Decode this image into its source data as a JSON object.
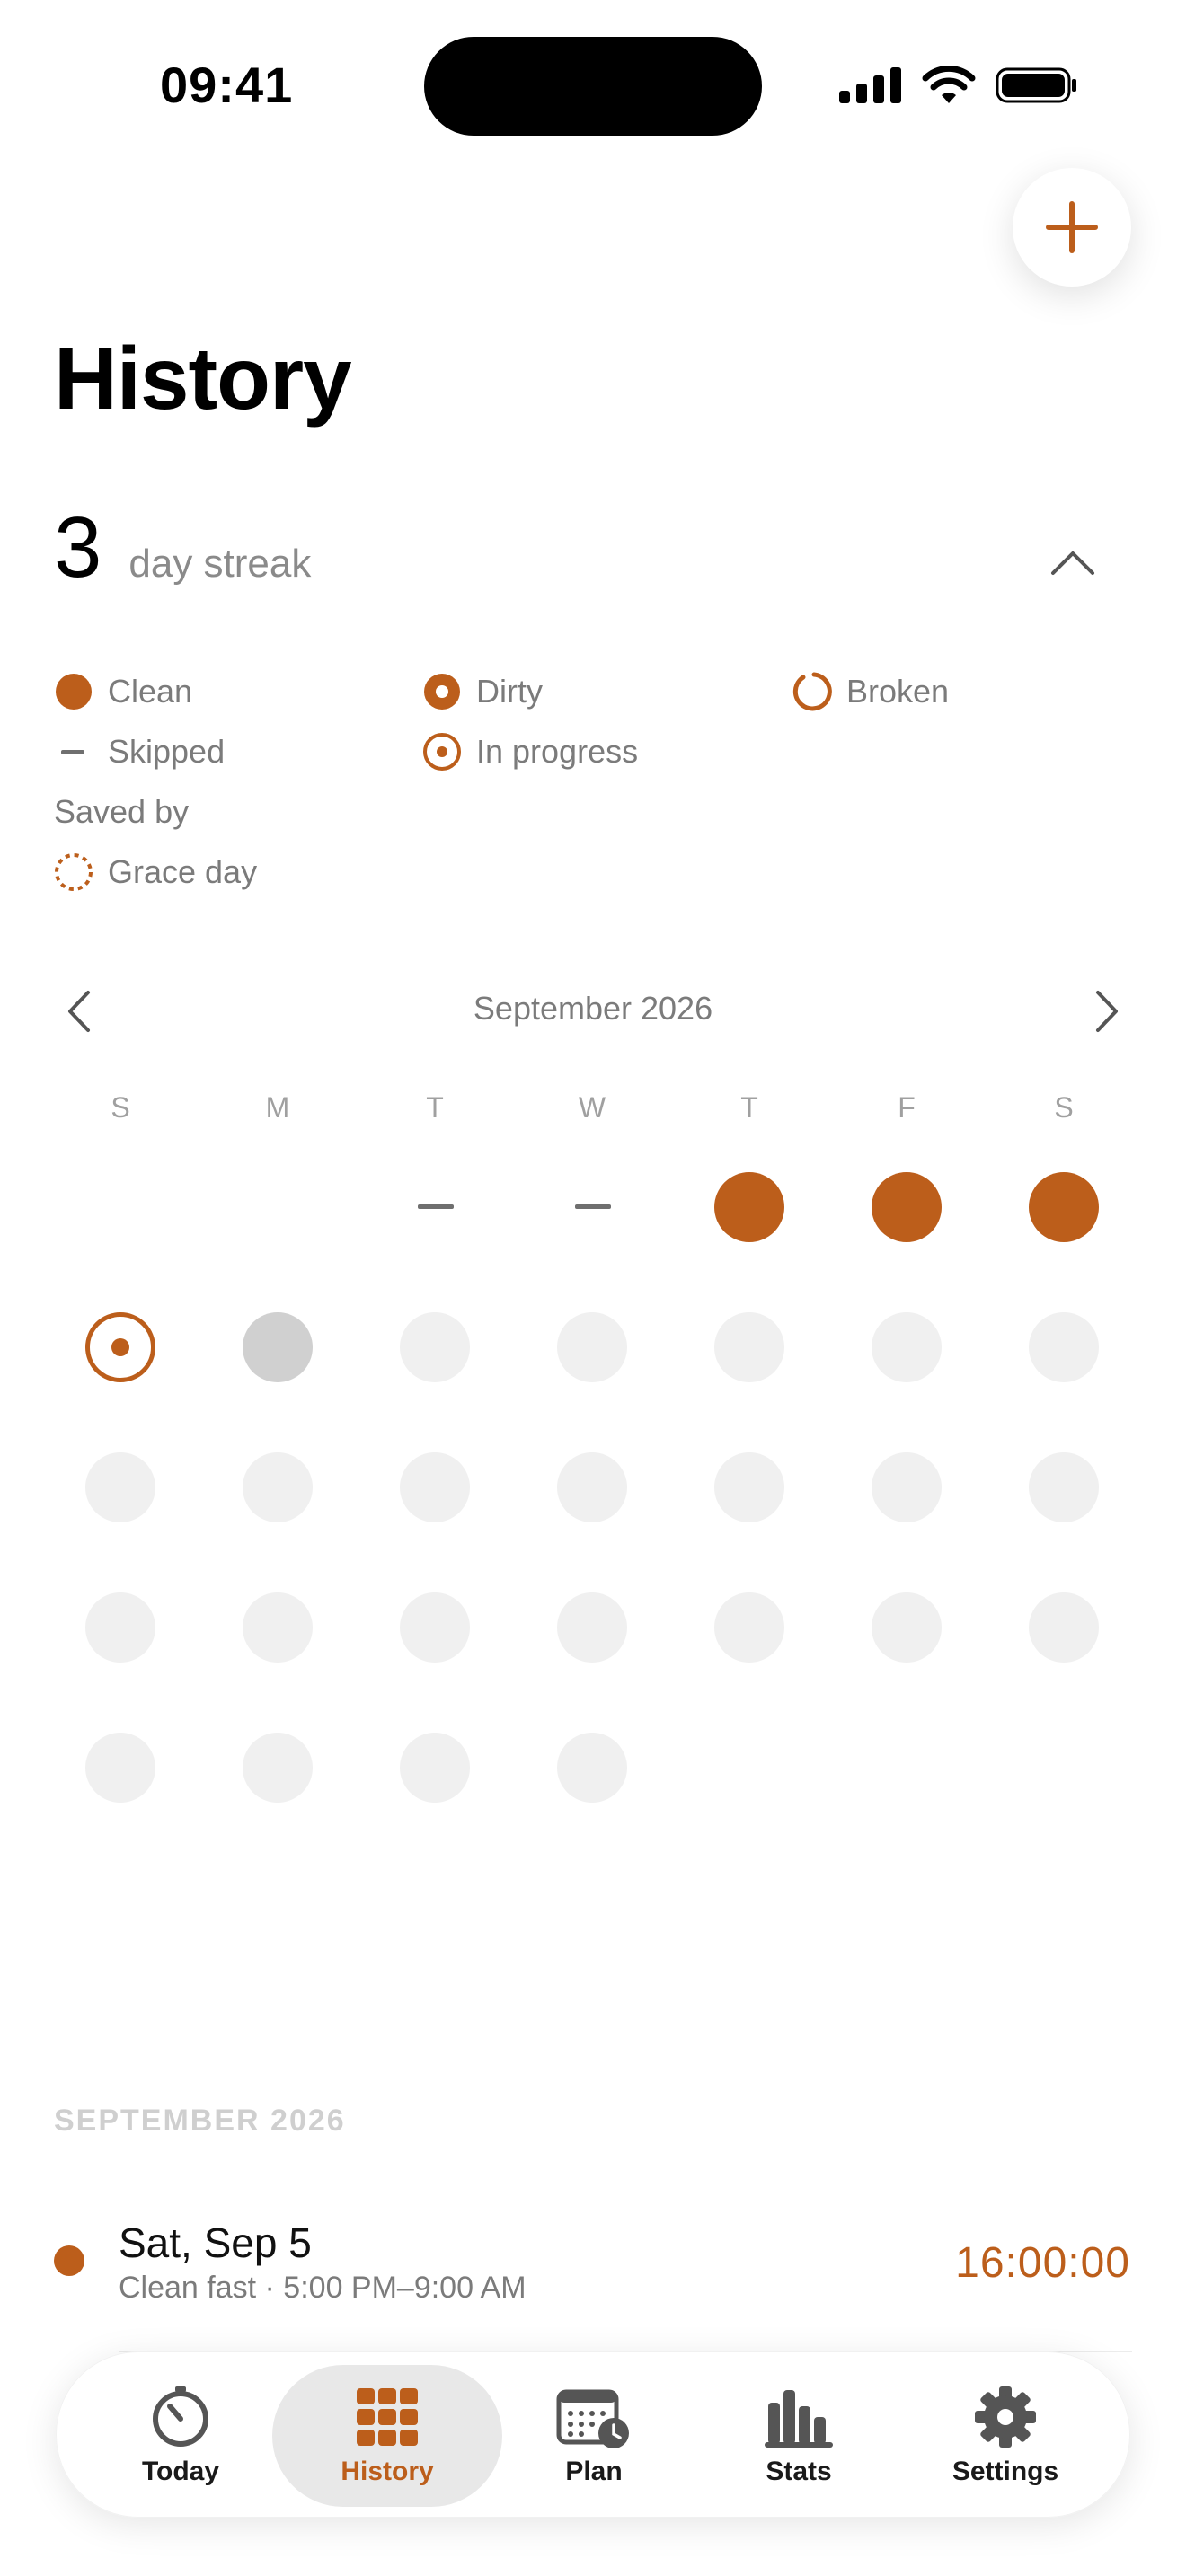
{
  "status_bar": {
    "time": "09:41"
  },
  "page": {
    "title": "History"
  },
  "streak": {
    "count": "3",
    "label": "day streak"
  },
  "legend": {
    "clean": "Clean",
    "dirty": "Dirty",
    "broken": "Broken",
    "skipped": "Skipped",
    "in_progress": "In progress",
    "saved_by": "Saved by",
    "grace_day": "Grace day"
  },
  "calendar": {
    "month": "September 2026",
    "weekdays": [
      "S",
      "M",
      "T",
      "W",
      "T",
      "F",
      "S"
    ],
    "first_weekday_index": 2,
    "days_in_month": 30,
    "day_states": {
      "1": "skipped",
      "2": "skipped",
      "3": "clean",
      "4": "clean",
      "5": "clean",
      "6": "in_progress",
      "7": "today"
    }
  },
  "colors": {
    "accent": "#bc5e1b",
    "future_day": "#f0f0f0",
    "today": "#d0d0d0"
  },
  "list": {
    "section": "SEPTEMBER 2026",
    "entries": [
      {
        "date": "Sat, Sep 5",
        "detail": "Clean fast · 5:00 PM–9:00 AM",
        "duration": "16:00:00",
        "status": "clean"
      }
    ]
  },
  "tabbar": {
    "tabs": [
      {
        "label": "Today",
        "icon": "timer-icon"
      },
      {
        "label": "History",
        "icon": "grid-icon",
        "active": true
      },
      {
        "label": "Plan",
        "icon": "calendar-clock-icon"
      },
      {
        "label": "Stats",
        "icon": "bar-chart-icon"
      },
      {
        "label": "Settings",
        "icon": "gear-icon"
      }
    ]
  }
}
